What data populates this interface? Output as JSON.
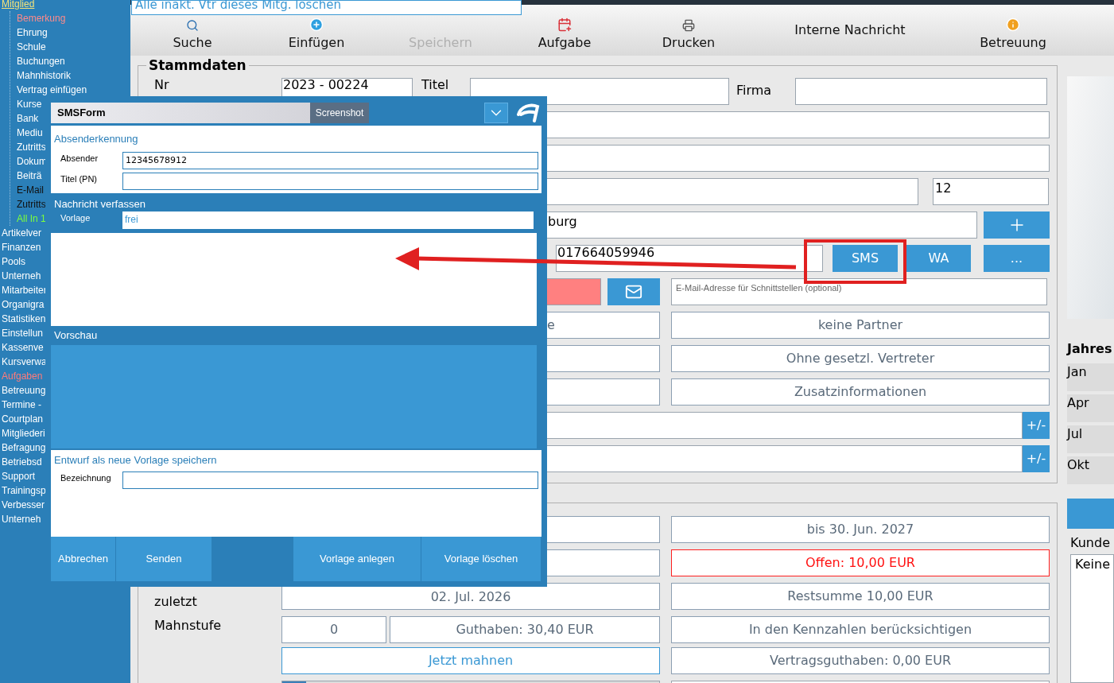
{
  "top_banner": {
    "text": "Alle inakt. Vtr dieses Mitg. löschen"
  },
  "sidebar": {
    "items": [
      {
        "label": "Mitglied",
        "color": "#f2e27a",
        "children": [
          {
            "label": "Bemerkung",
            "color": "#ff8a8a"
          },
          {
            "label": "Ehrung",
            "color": "#ffffff"
          },
          {
            "label": "Schule",
            "color": "#ffffff"
          },
          {
            "label": "Buchungen",
            "color": "#ffffff"
          },
          {
            "label": "Mahnhistorik",
            "color": "#ffffff"
          },
          {
            "label": "Vertrag einfügen",
            "color": "#ffffff"
          },
          {
            "label": "Kurse",
            "color": "#ffffff"
          },
          {
            "label": "Bank",
            "color": "#ffffff"
          },
          {
            "label": "Mediu",
            "color": "#ffffff"
          },
          {
            "label": "Zutritts",
            "color": "#ffffff"
          },
          {
            "label": "Dokum",
            "color": "#ffffff"
          },
          {
            "label": "Beiträ",
            "color": "#ffffff"
          },
          {
            "label": "E-Mail",
            "color": "#111111"
          },
          {
            "label": "Zutritts",
            "color": "#111111"
          },
          {
            "label": "All In 1",
            "color": "#7cff3c"
          }
        ]
      },
      {
        "label": "Artikelver",
        "color": "#ffffff"
      },
      {
        "label": "Finanzen",
        "color": "#ffffff"
      },
      {
        "label": "Pools",
        "color": "#ffffff"
      },
      {
        "label": "Unterneh",
        "color": "#ffffff"
      },
      {
        "label": "Mitarbeiter",
        "color": "#ffffff"
      },
      {
        "label": "Organigra",
        "color": "#ffffff"
      },
      {
        "label": "Statistiken",
        "color": "#ffffff"
      },
      {
        "label": "Einstellun",
        "color": "#ffffff"
      },
      {
        "label": "Kassenve",
        "color": "#ffffff"
      },
      {
        "label": "Kursverwa",
        "color": "#ffffff"
      },
      {
        "label": "Aufgaben",
        "color": "#ff7a7a"
      },
      {
        "label": "Betreuung",
        "color": "#ffffff"
      },
      {
        "label": "Termine -",
        "color": "#ffffff"
      },
      {
        "label": "Courtplan",
        "color": "#ffffff"
      },
      {
        "label": "Mitgliederi",
        "color": "#ffffff"
      },
      {
        "label": "Befragung",
        "color": "#ffffff"
      },
      {
        "label": "Betriebsd",
        "color": "#ffffff"
      },
      {
        "label": "Support",
        "color": "#ffffff"
      },
      {
        "label": "Trainingsp",
        "color": "#ffffff"
      },
      {
        "label": "Verbesser",
        "color": "#ffffff"
      },
      {
        "label": "Unterneh",
        "color": "#ffffff"
      }
    ]
  },
  "toolbar": [
    {
      "label": "Suche",
      "kind": "search",
      "disabled": false
    },
    {
      "label": "Einfügen",
      "kind": "add",
      "disabled": false
    },
    {
      "label": "Speichern",
      "kind": "plain",
      "disabled": true
    },
    {
      "label": "Aufgabe",
      "kind": "calendar",
      "disabled": false
    },
    {
      "label": "Drucken",
      "kind": "print",
      "disabled": false
    },
    {
      "label": "Interne Nachricht",
      "kind": "plain",
      "disabled": false
    },
    {
      "label": "Betreuung",
      "kind": "info",
      "disabled": false
    }
  ],
  "stammdaten": {
    "title": "Stammdaten",
    "nr_label": "Nr",
    "nr_value": "2023 - 00224",
    "titel_label": "Titel",
    "firma_label": "Firma",
    "house_number": "12",
    "city": "burg",
    "phone": "017664059946",
    "sms_button": "SMS",
    "wa_button": "WA",
    "more_button": "...",
    "email_placeholder": "E-Mail-Adresse für Schnittstellen (optional)",
    "option_rows": [
      {
        "left": "e",
        "right": "keine Partner"
      },
      {
        "left": "",
        "right": "Ohne gesetzl. Vertreter"
      },
      {
        "left": "",
        "right": "Zusatzinformationen"
      }
    ],
    "plusminus_rows": [
      "+/-",
      "+/-"
    ]
  },
  "contract": {
    "rows": [
      {
        "label": "",
        "left": "",
        "right": "bis 30. Jun. 2027",
        "alert": false
      },
      {
        "label": "",
        "left": "",
        "right": "Offen: 10,00 EUR",
        "alert": true
      },
      {
        "label": "zuletzt",
        "left": "02. Jul. 2026",
        "right": "Restsumme 10,00 EUR",
        "alert": false
      }
    ],
    "mahnstufe_label": "Mahnstufe",
    "mahnstufe_value": "0",
    "guthaben": "Guthaben: 30,40 EUR",
    "kennzahlen": "In den Kennzahlen berücksichtigen",
    "mahnen_button": "Jetzt mahnen",
    "vertragsguthaben": "Vertragsguthaben: 0,00 EUR"
  },
  "right_panel": {
    "title": "Jahres",
    "months": [
      "Jan",
      "Apr",
      "Jul",
      "Okt"
    ],
    "kunden_label": "Kunde",
    "kunden_value": "Keine"
  },
  "sms_form": {
    "title": "SMSForm",
    "screenshot_button": "Screenshot",
    "sender_section": "Absenderkennung",
    "sender_label": "Absender",
    "sender_value": "12345678912",
    "title_label": "Titel (PN)",
    "compose_section": "Nachricht verfassen",
    "template_label": "Vorlage",
    "template_value": "frei",
    "preview_section": "Vorschau",
    "save_section": "Entwurf als neue Vorlage speichern",
    "name_label": "Bezeichnung",
    "buttons": [
      "Abbrechen",
      "Senden",
      "Vorlage anlegen",
      "Vorlage löschen"
    ]
  }
}
